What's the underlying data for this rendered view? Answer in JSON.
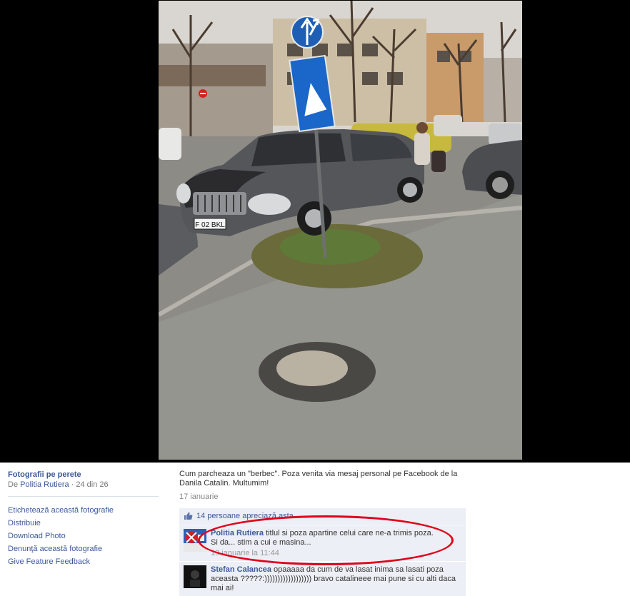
{
  "photo": {
    "alt": "",
    "plate_text": "F 02 BKL"
  },
  "album": {
    "title": "Fotografii pe perete",
    "by_prefix": "De",
    "owner": "Politia Rutiera",
    "position": "· 24 din 26"
  },
  "actions": [
    "Etichetează această fotografie",
    "Distribuie",
    "Download Photo",
    "Denunţă această fotografie",
    "Give Feature Feedback"
  ],
  "caption": "Cum parcheaza un \"berbec\". Poza venita via mesaj personal pe Facebook de la Danila Catalin. Multumim!",
  "date": "17 ianuarie",
  "likes": "14 persoane apreciază asta.",
  "comments": [
    {
      "author": "Politia Rutiera",
      "text_line1": "titlul si poza apartine celui care ne-a trimis poza.",
      "text_line2": "Si da... stim a cui e masina...",
      "time": "19 ianuarie la 11:44"
    },
    {
      "author": "Stefan Calancea",
      "text": "opaaaaa da cum de va lasat inima sa lasati poza aceasta ?????:)))))))))))))))))) bravo catalineee mai pune si cu alti daca mai ai!"
    }
  ],
  "colors": {
    "link": "#3b5998",
    "annotation": "#e0001b",
    "comment_bg": "#eceff5"
  }
}
